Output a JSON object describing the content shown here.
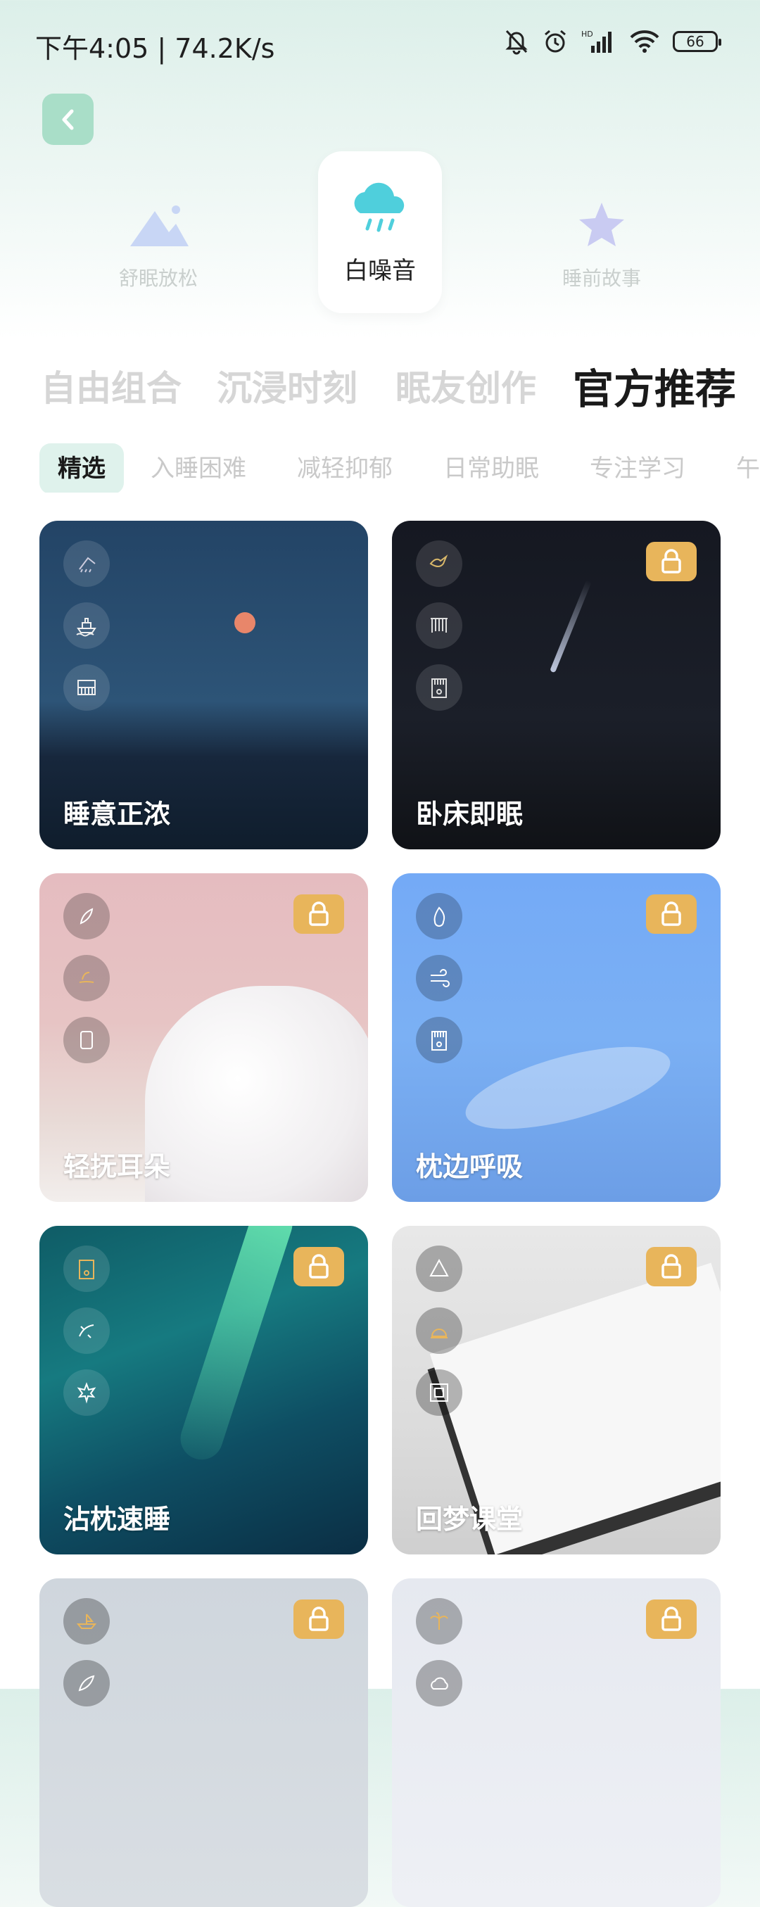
{
  "status_bar": {
    "time_speed": "下午4:05 | 74.2K/s",
    "battery": "66"
  },
  "categories": [
    {
      "label": "舒眠放松",
      "icon": "mountain-icon"
    },
    {
      "label": "白噪音",
      "icon": "rain-cloud-icon"
    },
    {
      "label": "睡前故事",
      "icon": "star-icon"
    }
  ],
  "tabs": [
    "自由组合",
    "沉浸时刻",
    "眠友创作",
    "官方推荐"
  ],
  "subtabs": [
    "精选",
    "入睡困难",
    "减轻抑郁",
    "日常助眠",
    "专注学习",
    "午"
  ],
  "cards": [
    {
      "title": "睡意正浓",
      "locked": false
    },
    {
      "title": "卧床即眠",
      "locked": true
    },
    {
      "title": "轻抚耳朵",
      "locked": true
    },
    {
      "title": "枕边呼吸",
      "locked": true
    },
    {
      "title": "沾枕速睡",
      "locked": true
    },
    {
      "title": "回梦课堂",
      "locked": true
    },
    {
      "title": "",
      "locked": true
    },
    {
      "title": "",
      "locked": true
    }
  ],
  "colors": {
    "accent": "#a9dec8",
    "lock": "#e8b55b",
    "active_subtab_bg": "#dff2ec"
  }
}
